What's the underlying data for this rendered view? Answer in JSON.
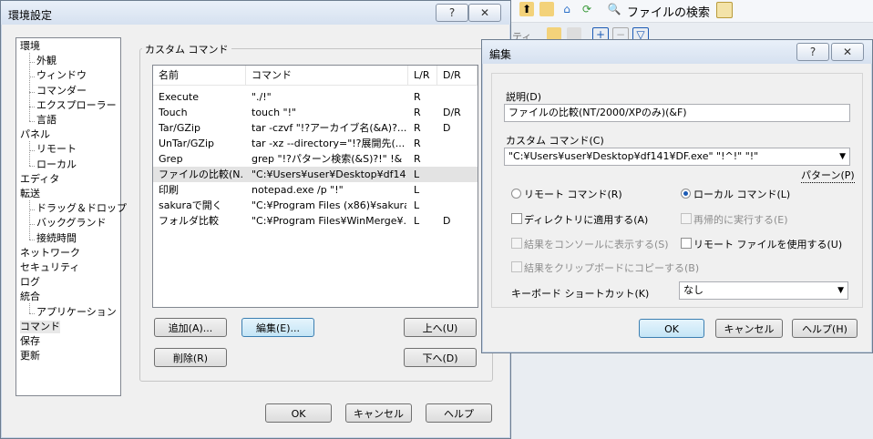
{
  "background_toolbar": {
    "file_search_label": "ファイルの検索",
    "partial_text": "ティ"
  },
  "settings_window": {
    "title": "環境設定",
    "help_btn": "?",
    "close_btn": "✕",
    "tree": [
      {
        "label": "環境",
        "level": 0
      },
      {
        "label": "外観",
        "level": 1
      },
      {
        "label": "ウィンドウ",
        "level": 1
      },
      {
        "label": "コマンダー",
        "level": 1
      },
      {
        "label": "エクスプローラー",
        "level": 1
      },
      {
        "label": "言語",
        "level": 1
      },
      {
        "label": "パネル",
        "level": 0
      },
      {
        "label": "リモート",
        "level": 1
      },
      {
        "label": "ローカル",
        "level": 1
      },
      {
        "label": "エディタ",
        "level": 0
      },
      {
        "label": "転送",
        "level": 0
      },
      {
        "label": "ドラッグ＆ドロップ",
        "level": 1
      },
      {
        "label": "バックグランド",
        "level": 1
      },
      {
        "label": "接続時間",
        "level": 1
      },
      {
        "label": "ネットワーク",
        "level": 0
      },
      {
        "label": "セキュリティ",
        "level": 0
      },
      {
        "label": "ログ",
        "level": 0
      },
      {
        "label": "統合",
        "level": 0
      },
      {
        "label": "アプリケーション",
        "level": 1
      },
      {
        "label": "コマンド",
        "level": 0
      },
      {
        "label": "保存",
        "level": 0
      },
      {
        "label": "更新",
        "level": 0
      }
    ],
    "group_label": "カスタム コマンド",
    "columns": [
      "名前",
      "コマンド",
      "L/R",
      "D/R"
    ],
    "rows": [
      {
        "name": "Execute",
        "command": "\"./!\"",
        "lr": "R",
        "dr": ""
      },
      {
        "name": "Touch",
        "command": "touch \"!\"",
        "lr": "R",
        "dr": "D/R"
      },
      {
        "name": "Tar/GZip",
        "command": "tar -czvf \"!?アーカイブ名(&A)?...",
        "lr": "R",
        "dr": "D"
      },
      {
        "name": "UnTar/GZip",
        "command": "tar -xz --directory=\"!?展開先(...",
        "lr": "R",
        "dr": ""
      },
      {
        "name": "Grep",
        "command": "grep \"!?パターン検索(&S)?!\" !&",
        "lr": "R",
        "dr": ""
      },
      {
        "name": "ファイルの比較(N...",
        "command": "\"C:¥Users¥user¥Desktop¥df14...",
        "lr": "L",
        "dr": ""
      },
      {
        "name": "印刷",
        "command": "notepad.exe /p \"!\"",
        "lr": "L",
        "dr": ""
      },
      {
        "name": "sakuraで開く",
        "command": "\"C:¥Program Files (x86)¥sakura\"",
        "lr": "L",
        "dr": ""
      },
      {
        "name": "フォルダ比較",
        "command": "\"C:¥Program Files¥WinMerge¥...",
        "lr": "L",
        "dr": "D"
      }
    ],
    "buttons": {
      "add": "追加(A)...",
      "edit": "編集(E)...",
      "up": "上へ(U)",
      "delete": "削除(R)",
      "down": "下へ(D)",
      "ok": "OK",
      "cancel": "キャンセル",
      "help": "ヘルプ"
    }
  },
  "edit_dialog": {
    "title": "編集",
    "help_btn": "?",
    "close_btn": "✕",
    "description_label": "説明(D)",
    "description_value": "ファイルの比較(NT/2000/XPのみ)(&F)",
    "custom_command_label": "カスタム コマンド(C)",
    "custom_command_value": "\"C:¥Users¥user¥Desktop¥df141¥DF.exe\" \"!^!\" \"!\"",
    "pattern_link": "パターン(P)",
    "remote_command": "リモート コマンド(R)",
    "local_command": "ローカル コマンド(L)",
    "selected_mode": "local",
    "apply_to_dirs": "ディレクトリに適用する(A)",
    "recursive": "再帰的に実行する(E)",
    "show_console": "結果をコンソールに表示する(S)",
    "use_remote_files": "リモート ファイルを使用する(U)",
    "copy_clipboard": "結果をクリップボードにコピーする(B)",
    "shortcut_label": "キーボード ショートカット(K)",
    "shortcut_value": "なし",
    "ok": "OK",
    "cancel": "キャンセル",
    "help": "ヘルプ(H)"
  }
}
